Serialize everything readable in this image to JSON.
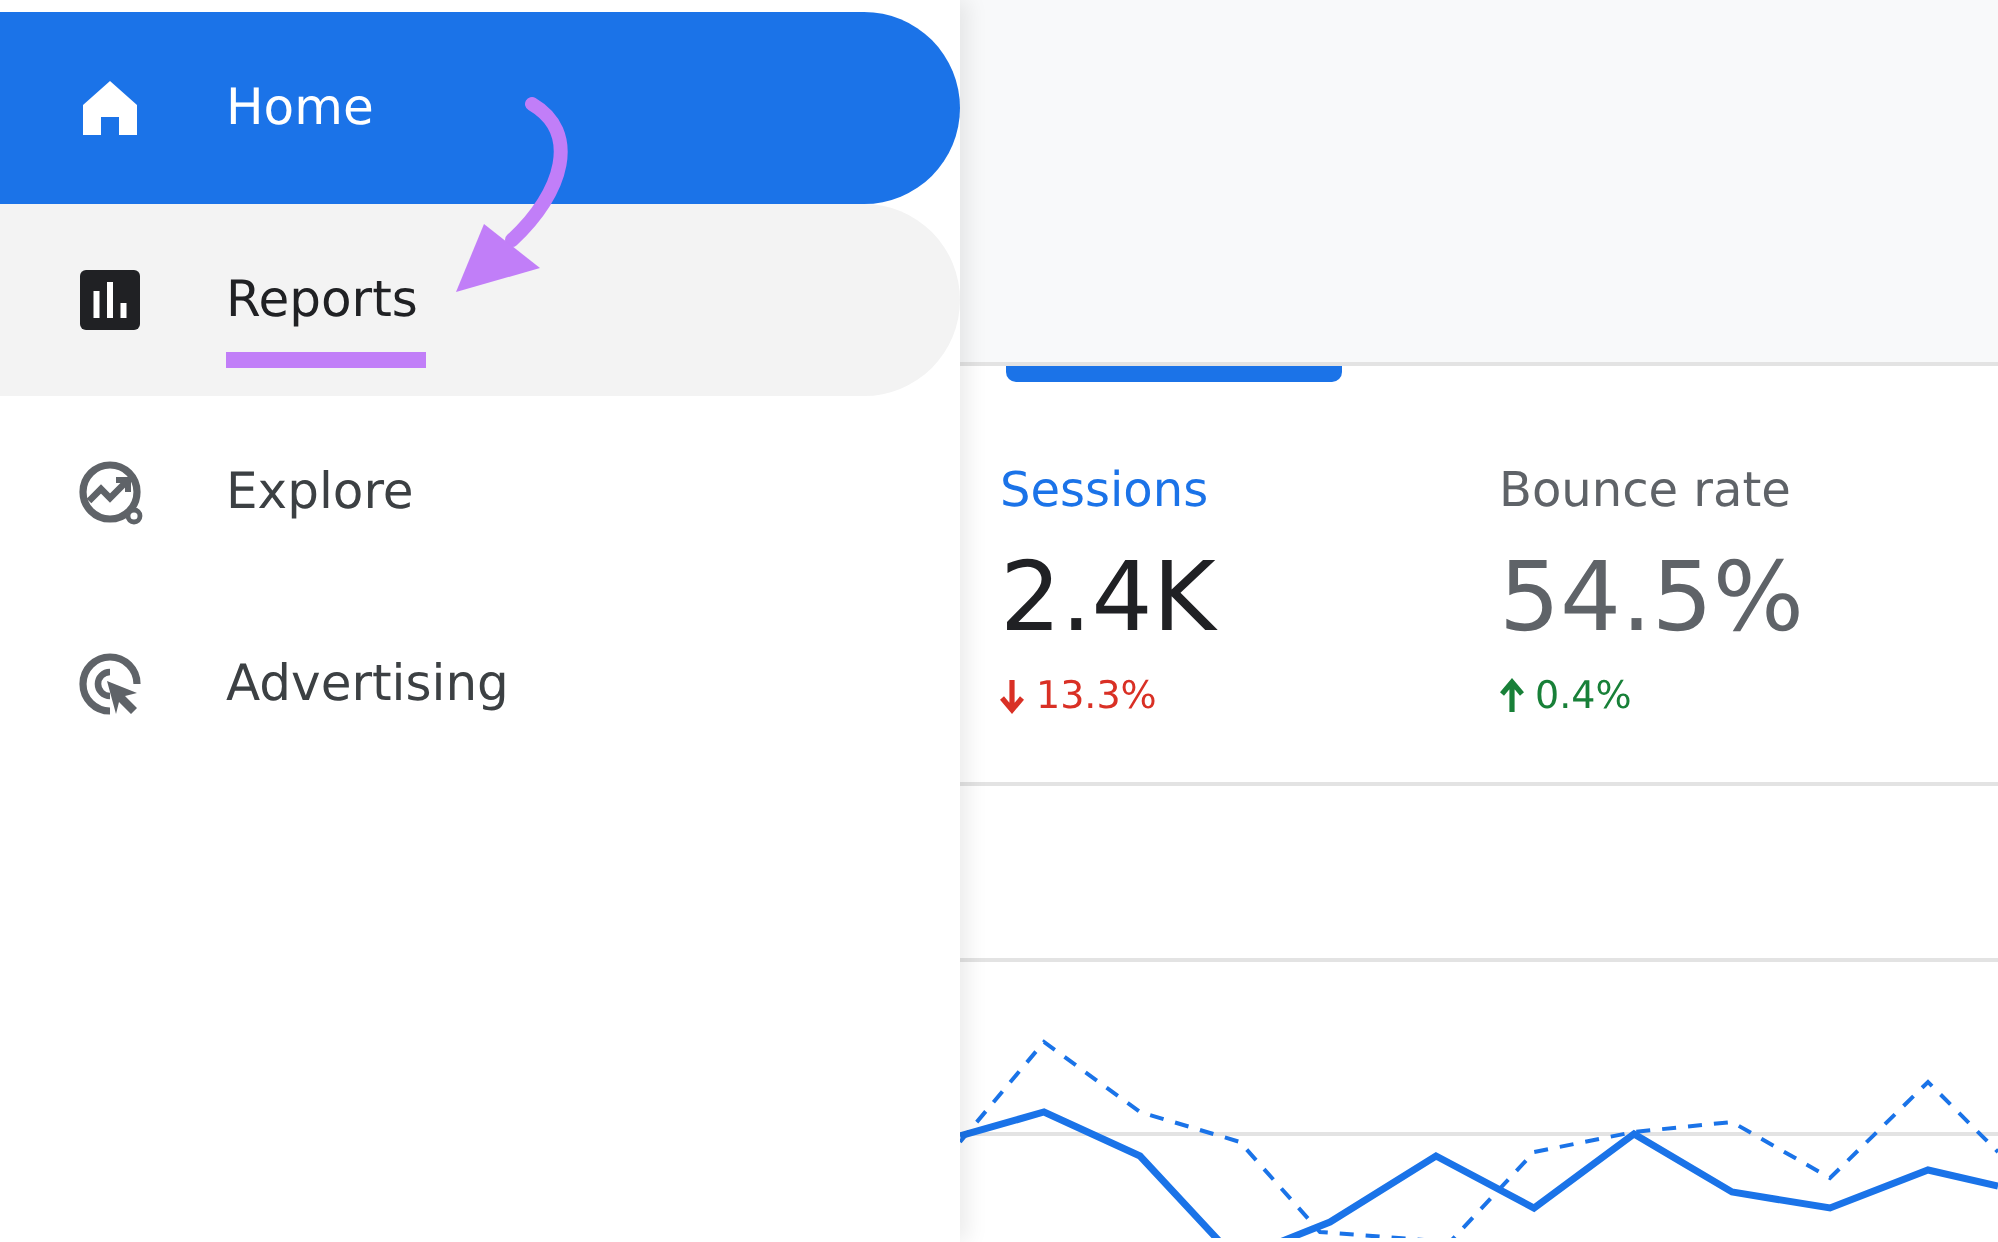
{
  "sidebar": {
    "items": [
      {
        "label": "Home",
        "kind": "home",
        "selected": true,
        "hovered": false,
        "annotated": false
      },
      {
        "label": "Reports",
        "kind": "reports",
        "selected": false,
        "hovered": true,
        "annotated": true
      },
      {
        "label": "Explore",
        "kind": "explore",
        "selected": false,
        "hovered": false,
        "annotated": false
      },
      {
        "label": "Advertising",
        "kind": "advertising",
        "selected": false,
        "hovered": false,
        "annotated": false
      }
    ]
  },
  "metrics": [
    {
      "label": "Sessions",
      "value": "2.4K",
      "change": "13.3%",
      "kind": "down",
      "selected": true
    },
    {
      "label": "Bounce rate",
      "value": "54.5%",
      "change": "0.4%",
      "kind": "up",
      "selected": false
    }
  ]
}
